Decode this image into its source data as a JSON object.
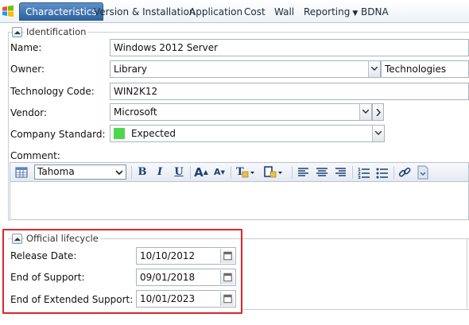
{
  "tabs": [
    {
      "label": "Characteristics",
      "active": true
    },
    {
      "label": "Version & Installation"
    },
    {
      "label": "Application"
    },
    {
      "label": "Cost"
    },
    {
      "label": "Wall"
    },
    {
      "label": "Reporting"
    },
    {
      "label": "BDNA"
    }
  ],
  "identification": {
    "legend": "Identification",
    "name_label": "Name:",
    "name_value": "Windows 2012 Server",
    "owner_label": "Owner:",
    "owner_value": "Library",
    "owner_value2": "Technologies",
    "tech_code_label": "Technology Code:",
    "tech_code_value": "WIN2K12",
    "vendor_label": "Vendor:",
    "vendor_value": "Microsoft",
    "company_standard_label": "Company Standard:",
    "company_standard_value": "Expected",
    "company_standard_color": "#4cd84c",
    "comment_label": "Comment:",
    "font_value": "Tahoma"
  },
  "lifecycle": {
    "legend": "Official lifecycle",
    "release_label": "Release Date:",
    "release_value": "10/10/2012",
    "eos_label": "End of Support:",
    "eos_value": "09/01/2018",
    "eoes_label": "End of Extended Support:",
    "eoes_value": "10/01/2023"
  },
  "colors": {
    "accent": "#2d62a0",
    "highlight": "#e0252b"
  }
}
